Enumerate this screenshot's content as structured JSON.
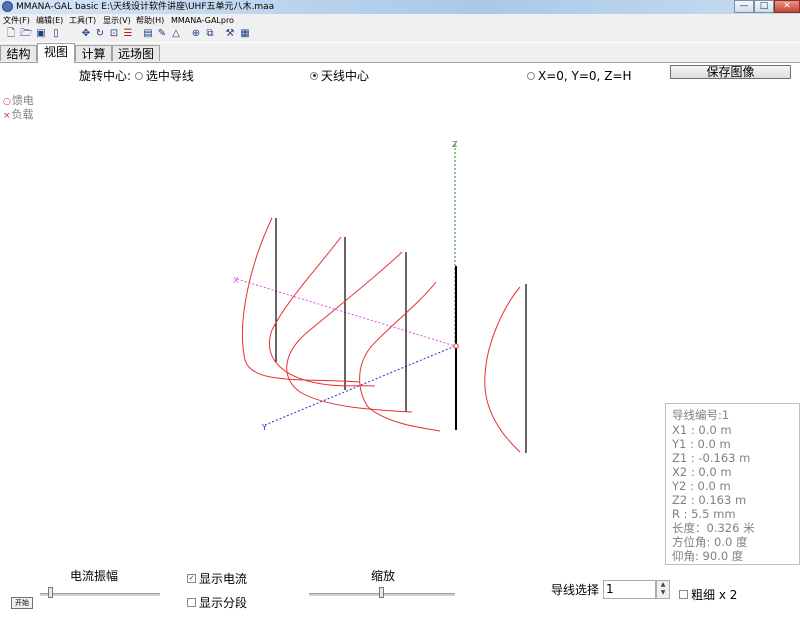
{
  "window": {
    "title": "MMANA-GAL basic E:\\天线设计软件讲座\\UHF五单元八木.maa",
    "minimize": "—",
    "maximize": "□",
    "close": "✕"
  },
  "menu": [
    "文件(F)",
    "编辑(E)",
    "工具(T)",
    "显示(V)",
    "帮助(H)",
    "MMANA-GALpro"
  ],
  "toolbar_icons": [
    "new-file-icon",
    "open-folder-icon",
    "save-icon",
    "info-icon",
    "move-icon",
    "rotate-icon",
    "zoom-icon",
    "align-icon",
    "page-icon",
    "edit-icon",
    "triangle-icon",
    "target-icon",
    "copy-icon",
    "tools-icon",
    "calculator-icon"
  ],
  "tabs": [
    "结构",
    "视图",
    "计算",
    "远场图"
  ],
  "rotation": {
    "label": "旋转中心:",
    "options": [
      "选中导线",
      "天线中心",
      "X=0, Y=0, Z=H"
    ],
    "selected": "天线中心"
  },
  "save_button": "保存图像",
  "legend": {
    "feed": "馈电",
    "load": "负载",
    "feed_marker": "○",
    "load_marker": "×"
  },
  "axes": {
    "x": "X",
    "y": "Y",
    "z": "Z"
  },
  "wire_info": {
    "number": "导线编号:1",
    "x1": "X1   :  0.0 m",
    "y1": "Y1   :  0.0 m",
    "z1": "Z1   :  -0.163 m",
    "x2": "X2   :  0.0 m",
    "y2": "Y2   :  0.0 m",
    "z2": "Z2   :  0.163 m",
    "r": "R    :  5.5 mm",
    "length": "长度：0.326 米",
    "azimuth": "方位角:  0.0 度",
    "elevation": "仰角:  90.0 度"
  },
  "bottom": {
    "current_amplitude": "电流振幅",
    "start_button": "开始",
    "show_current": "显示电流",
    "show_current_checked": true,
    "show_segments": "显示分段",
    "show_segments_checked": false,
    "zoom": "缩放",
    "wire_select_label": "导线选择",
    "wire_select_value": "1",
    "thick_label": "粗细 x 2",
    "thick_checked": false
  },
  "colors": {
    "current": "#e83030",
    "x_axis": "#e050e0",
    "y_axis": "#2a2ad0",
    "z_axis": "#2a8a2a",
    "wire": "#000000"
  }
}
